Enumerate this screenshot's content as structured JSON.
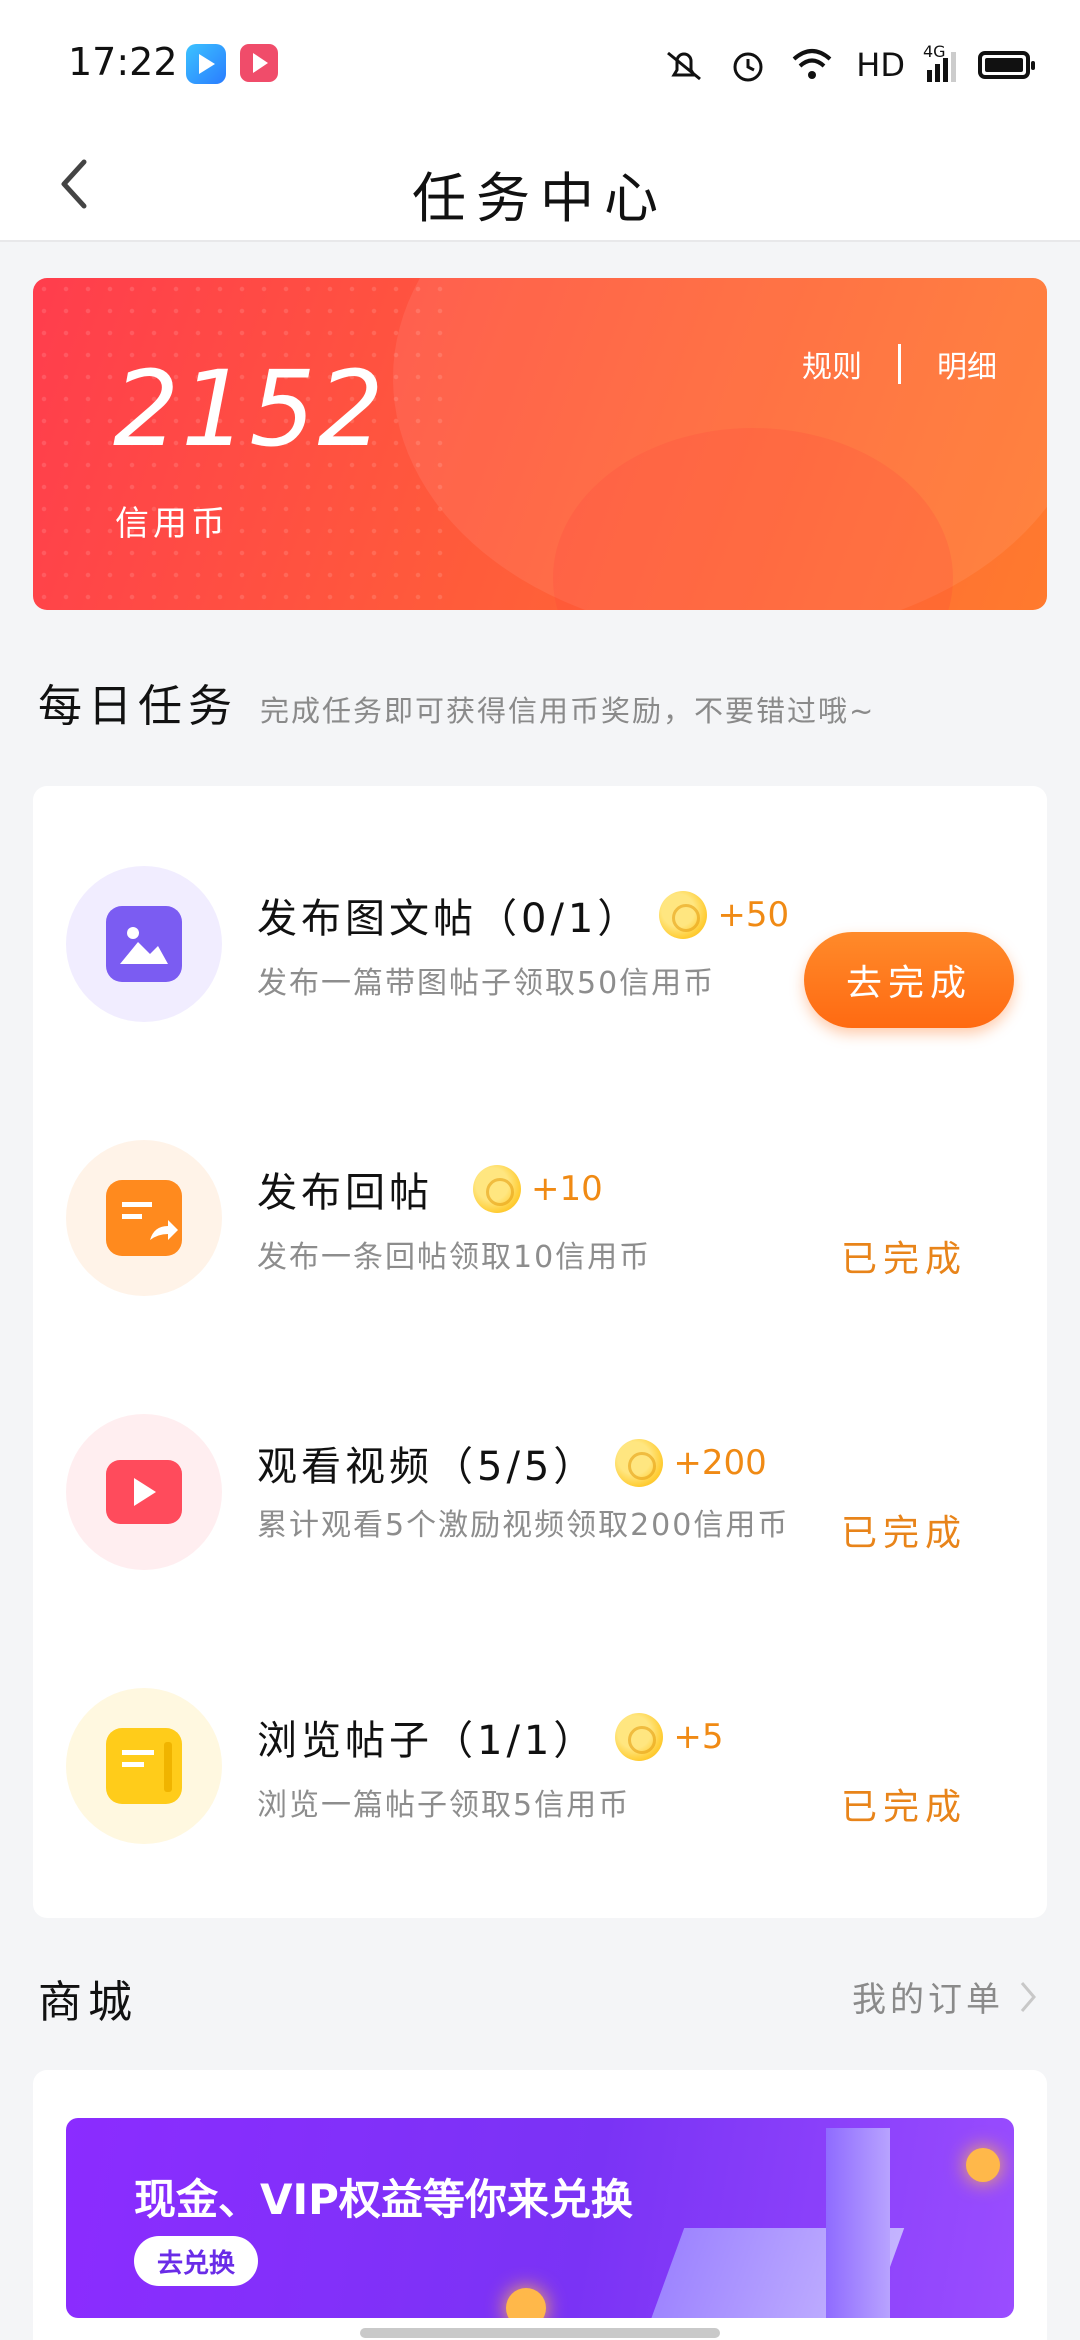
{
  "status_bar": {
    "time": "17:22",
    "network": "HD",
    "signal": "4G",
    "icons": [
      "mute-icon",
      "alarm-icon",
      "wifi-icon",
      "signal-icon",
      "battery-icon"
    ]
  },
  "header": {
    "title": "任务中心",
    "back_icon": "chevron-left-icon"
  },
  "balance": {
    "amount": "2152",
    "unit": "信用币",
    "rules_link": "规则",
    "detail_link": "明细"
  },
  "daily_tasks": {
    "title": "每日任务",
    "subtitle": "完成任务即可获得信用币奖励，不要错过哦~",
    "items": [
      {
        "name": "发布图文帖（0/1）",
        "reward": "+50",
        "desc": "发布一篇带图帖子领取50信用币",
        "action": "去完成",
        "status": "pending",
        "icon": "image-post-icon",
        "icon_color": "#7b5cf2",
        "icon_bg": "#f1edff"
      },
      {
        "name": "发布回帖",
        "reward": "+10",
        "desc": "发布一条回帖领取10信用币",
        "action": "已完成",
        "status": "done",
        "icon": "reply-post-icon",
        "icon_color": "#ff8a1e",
        "icon_bg": "#fff3e8"
      },
      {
        "name": "观看视频（5/5）",
        "reward": "+200",
        "desc": "累计观看5个激励视频领取200信用币",
        "action": "已完成",
        "status": "done",
        "icon": "video-play-icon",
        "icon_color": "#ff4b5c",
        "icon_bg": "#ffeef0"
      },
      {
        "name": "浏览帖子（1/1）",
        "reward": "+5",
        "desc": "浏览一篇帖子领取5信用币",
        "action": "已完成",
        "status": "done",
        "icon": "browse-post-icon",
        "icon_color": "#ffcc1a",
        "icon_bg": "#fff8e0"
      }
    ]
  },
  "mall": {
    "title": "商城",
    "orders_link": "我的订单",
    "banner_title": "现金、VIP权益等你来兑换",
    "banner_button": "去兑换"
  },
  "colors": {
    "accent_orange": "#ff7a1e",
    "done_text": "#e8841a",
    "card_gradient_start": "#ff3d4d",
    "card_gradient_end": "#ff7a2e",
    "banner_purple": "#8b2cff"
  }
}
